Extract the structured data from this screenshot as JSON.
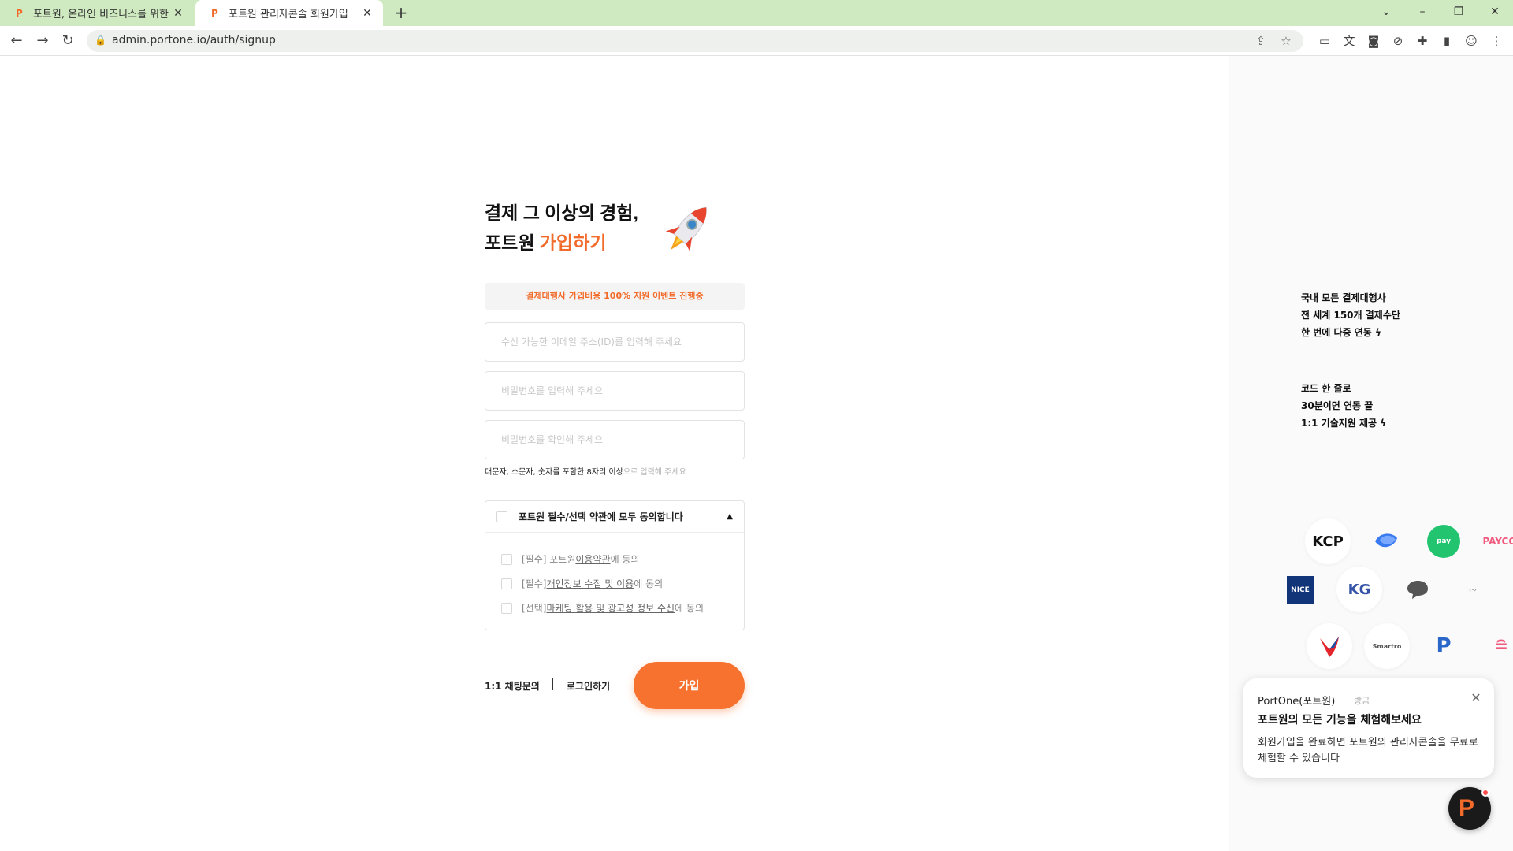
{
  "browser": {
    "tabs": [
      {
        "label": "포트원, 온라인 비즈니스를 위한",
        "active": false
      },
      {
        "label": "포트원 관리자콘솔 회원가입",
        "active": true
      }
    ],
    "new_tab": "+",
    "url": "admin.portone.io/auth/signup"
  },
  "signup": {
    "headline_line1": "결제 그 이상의 경험,",
    "headline_prefix": "포트원 ",
    "headline_accent": "가입하기",
    "promo": "결제대행사 가입비용 100% 지원 이벤트 진행중",
    "email_placeholder": "수신 가능한 이메일 주소(ID)를 입력해 주세요",
    "password_placeholder": "비밀번호를 입력해 주세요",
    "password_confirm_placeholder": "비밀번호를 확인해 주세요",
    "password_hint_strong": "대문자, 소문자, 숫자를 포함한 8자리 이상",
    "password_hint_rest": "으로 입력해 주세요",
    "terms_all_label": "포트원 필수/선택 약관에 모두 동의합니다",
    "terms": [
      {
        "prefix": "[필수] 포트원 ",
        "link": "이용약관",
        "suffix": "에 동의"
      },
      {
        "prefix": "[필수] ",
        "link": "개인정보 수집 및 이용",
        "suffix": "에 동의"
      },
      {
        "prefix": "[선택] ",
        "link": "마케팅 활용 및 광고성 정보 수신",
        "suffix": "에 동의"
      }
    ],
    "chat_link": "1:1 채팅문의",
    "login_link": "로그인하기",
    "signup_button": "가입"
  },
  "marketing": {
    "block1": [
      "국내 모든 결제대행사",
      "전 세계 150개 결제수단",
      "한 번에 다중 연동"
    ],
    "block2": [
      "코드 한 줄로",
      "30분이면 연동 끝",
      "1:1 기술지원 제공"
    ],
    "logos": [
      "KCP",
      "PAYCO",
      "NICE",
      "KG",
      "PayPal"
    ]
  },
  "chat_popup": {
    "sender": "PortOne(포트원)",
    "time": "방금",
    "title": "포트원의 모든 기능을 체험해보세요",
    "body": "회원가입을 완료하면 포트원의 관리자콘솔을 무료로 체험할 수 있습니다"
  },
  "colors": {
    "accent": "#f26b2a",
    "tab_bar": "#cfe9c0"
  }
}
